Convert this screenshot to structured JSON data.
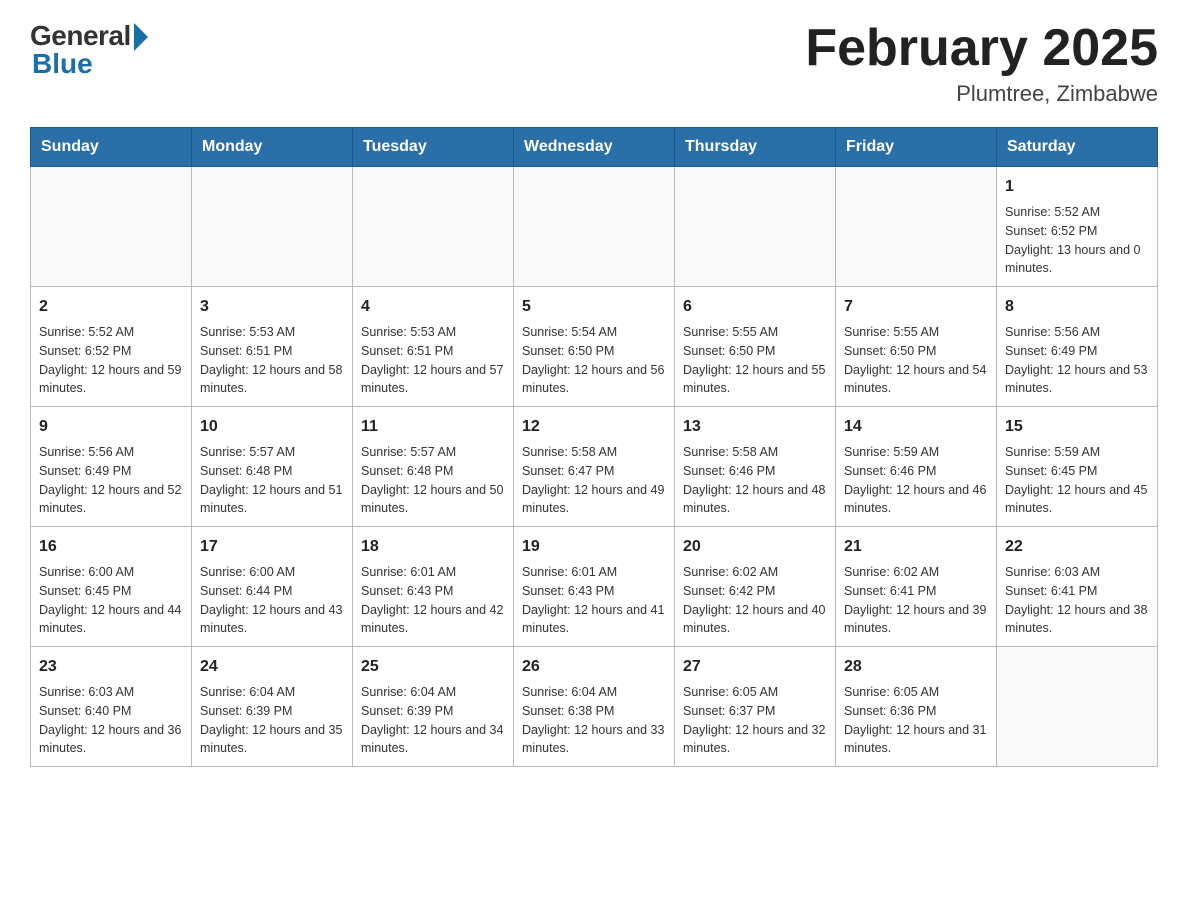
{
  "logo": {
    "general": "General",
    "blue": "Blue"
  },
  "title": "February 2025",
  "subtitle": "Plumtree, Zimbabwe",
  "days_of_week": [
    "Sunday",
    "Monday",
    "Tuesday",
    "Wednesday",
    "Thursday",
    "Friday",
    "Saturday"
  ],
  "weeks": [
    [
      {
        "day": "",
        "info": ""
      },
      {
        "day": "",
        "info": ""
      },
      {
        "day": "",
        "info": ""
      },
      {
        "day": "",
        "info": ""
      },
      {
        "day": "",
        "info": ""
      },
      {
        "day": "",
        "info": ""
      },
      {
        "day": "1",
        "info": "Sunrise: 5:52 AM\nSunset: 6:52 PM\nDaylight: 13 hours and 0 minutes."
      }
    ],
    [
      {
        "day": "2",
        "info": "Sunrise: 5:52 AM\nSunset: 6:52 PM\nDaylight: 12 hours and 59 minutes."
      },
      {
        "day": "3",
        "info": "Sunrise: 5:53 AM\nSunset: 6:51 PM\nDaylight: 12 hours and 58 minutes."
      },
      {
        "day": "4",
        "info": "Sunrise: 5:53 AM\nSunset: 6:51 PM\nDaylight: 12 hours and 57 minutes."
      },
      {
        "day": "5",
        "info": "Sunrise: 5:54 AM\nSunset: 6:50 PM\nDaylight: 12 hours and 56 minutes."
      },
      {
        "day": "6",
        "info": "Sunrise: 5:55 AM\nSunset: 6:50 PM\nDaylight: 12 hours and 55 minutes."
      },
      {
        "day": "7",
        "info": "Sunrise: 5:55 AM\nSunset: 6:50 PM\nDaylight: 12 hours and 54 minutes."
      },
      {
        "day": "8",
        "info": "Sunrise: 5:56 AM\nSunset: 6:49 PM\nDaylight: 12 hours and 53 minutes."
      }
    ],
    [
      {
        "day": "9",
        "info": "Sunrise: 5:56 AM\nSunset: 6:49 PM\nDaylight: 12 hours and 52 minutes."
      },
      {
        "day": "10",
        "info": "Sunrise: 5:57 AM\nSunset: 6:48 PM\nDaylight: 12 hours and 51 minutes."
      },
      {
        "day": "11",
        "info": "Sunrise: 5:57 AM\nSunset: 6:48 PM\nDaylight: 12 hours and 50 minutes."
      },
      {
        "day": "12",
        "info": "Sunrise: 5:58 AM\nSunset: 6:47 PM\nDaylight: 12 hours and 49 minutes."
      },
      {
        "day": "13",
        "info": "Sunrise: 5:58 AM\nSunset: 6:46 PM\nDaylight: 12 hours and 48 minutes."
      },
      {
        "day": "14",
        "info": "Sunrise: 5:59 AM\nSunset: 6:46 PM\nDaylight: 12 hours and 46 minutes."
      },
      {
        "day": "15",
        "info": "Sunrise: 5:59 AM\nSunset: 6:45 PM\nDaylight: 12 hours and 45 minutes."
      }
    ],
    [
      {
        "day": "16",
        "info": "Sunrise: 6:00 AM\nSunset: 6:45 PM\nDaylight: 12 hours and 44 minutes."
      },
      {
        "day": "17",
        "info": "Sunrise: 6:00 AM\nSunset: 6:44 PM\nDaylight: 12 hours and 43 minutes."
      },
      {
        "day": "18",
        "info": "Sunrise: 6:01 AM\nSunset: 6:43 PM\nDaylight: 12 hours and 42 minutes."
      },
      {
        "day": "19",
        "info": "Sunrise: 6:01 AM\nSunset: 6:43 PM\nDaylight: 12 hours and 41 minutes."
      },
      {
        "day": "20",
        "info": "Sunrise: 6:02 AM\nSunset: 6:42 PM\nDaylight: 12 hours and 40 minutes."
      },
      {
        "day": "21",
        "info": "Sunrise: 6:02 AM\nSunset: 6:41 PM\nDaylight: 12 hours and 39 minutes."
      },
      {
        "day": "22",
        "info": "Sunrise: 6:03 AM\nSunset: 6:41 PM\nDaylight: 12 hours and 38 minutes."
      }
    ],
    [
      {
        "day": "23",
        "info": "Sunrise: 6:03 AM\nSunset: 6:40 PM\nDaylight: 12 hours and 36 minutes."
      },
      {
        "day": "24",
        "info": "Sunrise: 6:04 AM\nSunset: 6:39 PM\nDaylight: 12 hours and 35 minutes."
      },
      {
        "day": "25",
        "info": "Sunrise: 6:04 AM\nSunset: 6:39 PM\nDaylight: 12 hours and 34 minutes."
      },
      {
        "day": "26",
        "info": "Sunrise: 6:04 AM\nSunset: 6:38 PM\nDaylight: 12 hours and 33 minutes."
      },
      {
        "day": "27",
        "info": "Sunrise: 6:05 AM\nSunset: 6:37 PM\nDaylight: 12 hours and 32 minutes."
      },
      {
        "day": "28",
        "info": "Sunrise: 6:05 AM\nSunset: 6:36 PM\nDaylight: 12 hours and 31 minutes."
      },
      {
        "day": "",
        "info": ""
      }
    ]
  ]
}
